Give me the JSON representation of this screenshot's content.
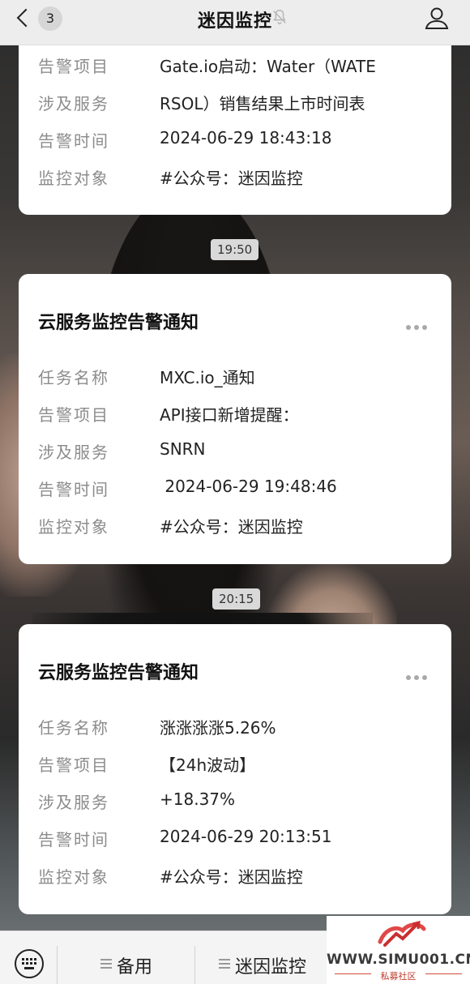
{
  "header": {
    "unread_count": "3",
    "title": "迷因监控"
  },
  "chat": {
    "card1": {
      "rows": [
        {
          "label": "告警项目",
          "value": "Gate.io启动：Water（WATE"
        },
        {
          "label": "涉及服务",
          "value": "RSOL）销售结果上市时间表"
        },
        {
          "label": "告警时间",
          "value": "2024-06-29 18:43:18"
        },
        {
          "label": "监控对象",
          "value": "#公众号：迷因监控"
        }
      ]
    },
    "time2": "19:50",
    "card2": {
      "title": "云服务监控告警通知",
      "rows": [
        {
          "label": "任务名称",
          "value": "MXC.io_通知"
        },
        {
          "label": "告警项目",
          "value": "API接口新增提醒："
        },
        {
          "label": "涉及服务",
          "value": "SNRN"
        },
        {
          "label": "告警时间",
          "value": " 2024-06-29 19:48:46"
        },
        {
          "label": "监控对象",
          "value": "#公众号：迷因监控"
        }
      ]
    },
    "time3": "20:15",
    "card3": {
      "title": "云服务监控告警通知",
      "rows": [
        {
          "label": "任务名称",
          "value": "涨涨涨涨5.26%"
        },
        {
          "label": "告警项目",
          "value": "【24h波动】"
        },
        {
          "label": "涉及服务",
          "value": "+18.37%"
        },
        {
          "label": "告警时间",
          "value": "2024-06-29 20:13:51"
        },
        {
          "label": "监控对象",
          "value": "#公众号：迷因监控"
        }
      ]
    }
  },
  "bottom_menu": {
    "items": [
      "备用",
      "迷因监控"
    ]
  },
  "watermark": {
    "site": "WWW.SIMU001.CN",
    "caption": "私募社区"
  },
  "icons": {
    "back": "chevron-left-icon",
    "mute": "bell-muted-icon",
    "profile": "person-icon",
    "more": "more-dots-icon",
    "keyboard": "keyboard-icon",
    "menu": "hamburger-icon"
  }
}
